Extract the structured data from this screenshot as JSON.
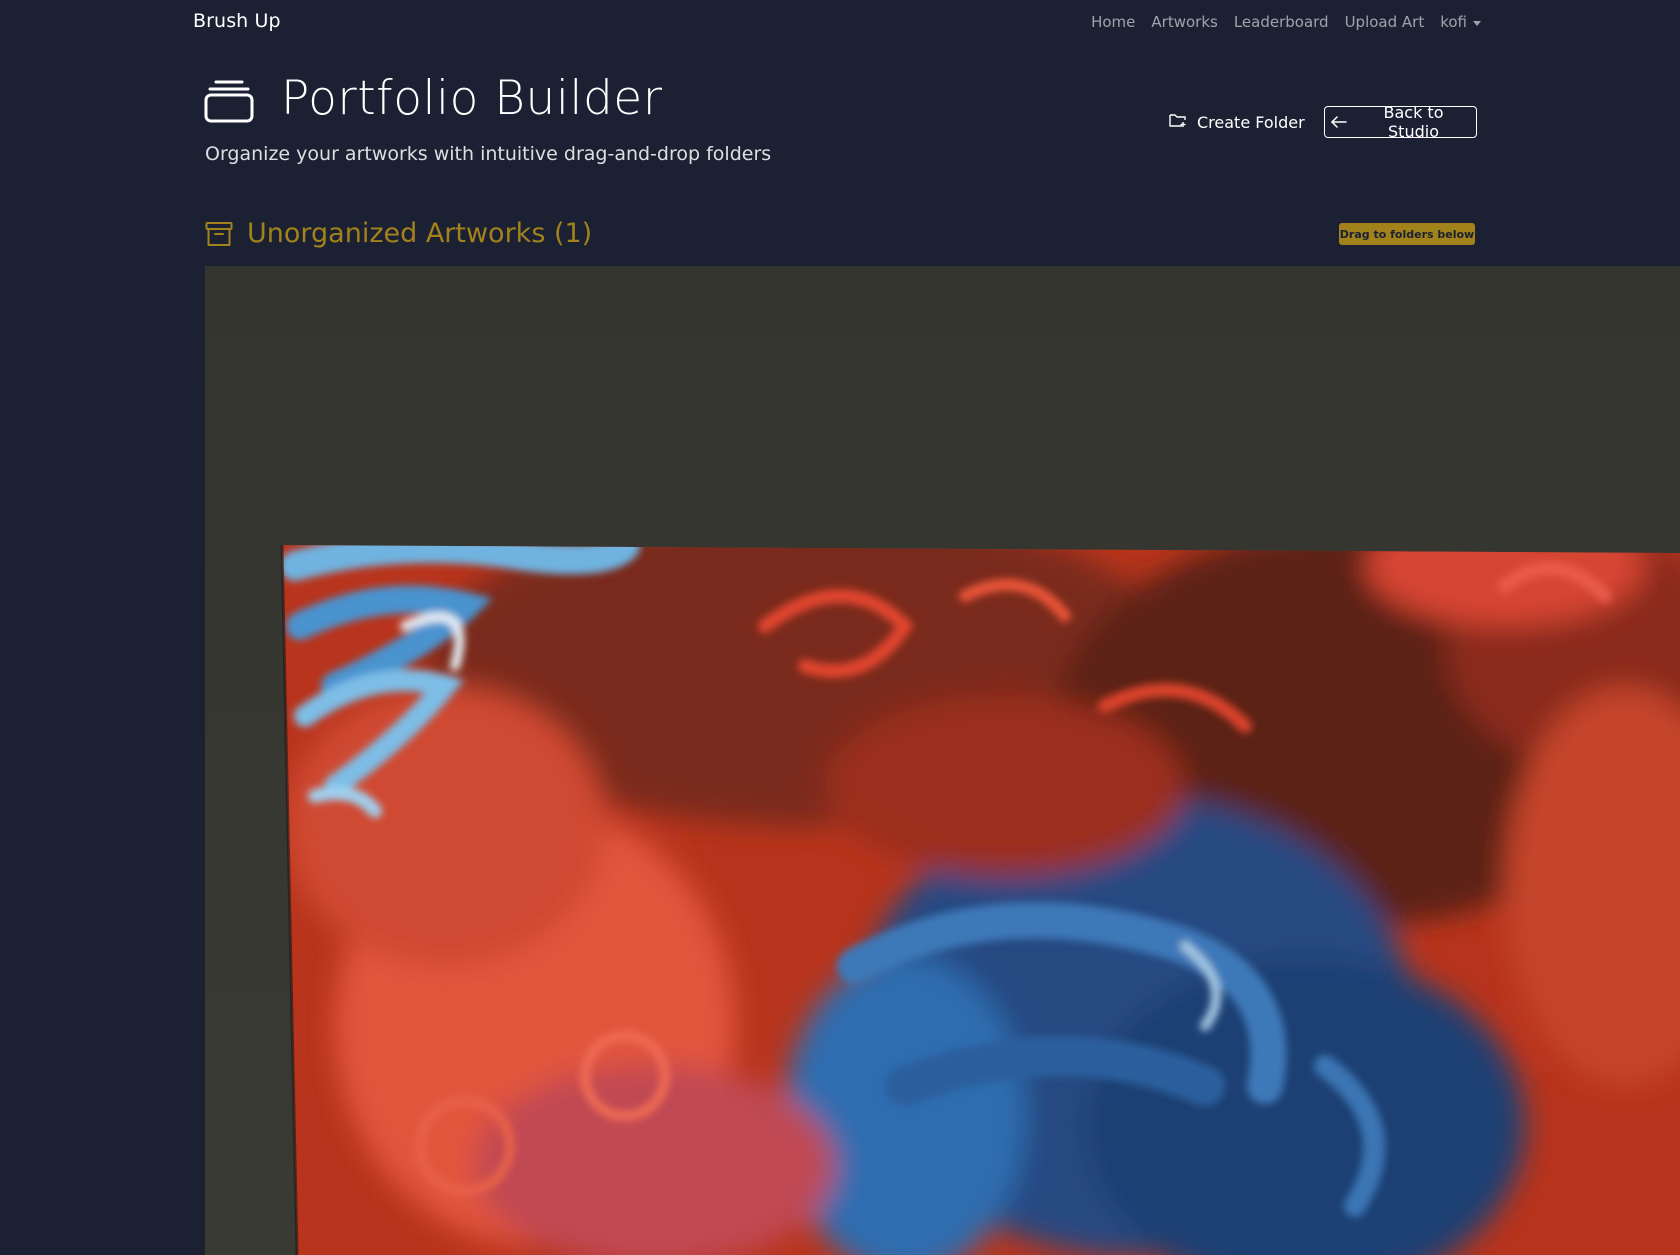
{
  "navbar": {
    "brand": "Brush Up",
    "links": [
      {
        "label": "Home"
      },
      {
        "label": "Artworks"
      },
      {
        "label": "Leaderboard"
      },
      {
        "label": "Upload Art"
      }
    ],
    "user": "kofi"
  },
  "header": {
    "icon": "collection-stack-icon",
    "title": "Portfolio Builder",
    "subtitle": "Organize your artworks with intuitive drag-and-drop folders",
    "create_folder_label": "Create Folder",
    "create_folder_icon": "folder-plus-icon",
    "back_label": "Back to Studio",
    "back_icon": "arrow-left-icon"
  },
  "unorganized": {
    "icon": "archive-box-icon",
    "title": "Unorganized Artworks (1)",
    "badge": "Drag to folders below",
    "artworks": [
      {
        "description_icon": "abstract-painting-thumbnail"
      }
    ]
  },
  "colors": {
    "background": "#1b2132",
    "accent_gold": "#a1821b",
    "nav_link": "#9aa0aa",
    "text": "#ffffff"
  }
}
